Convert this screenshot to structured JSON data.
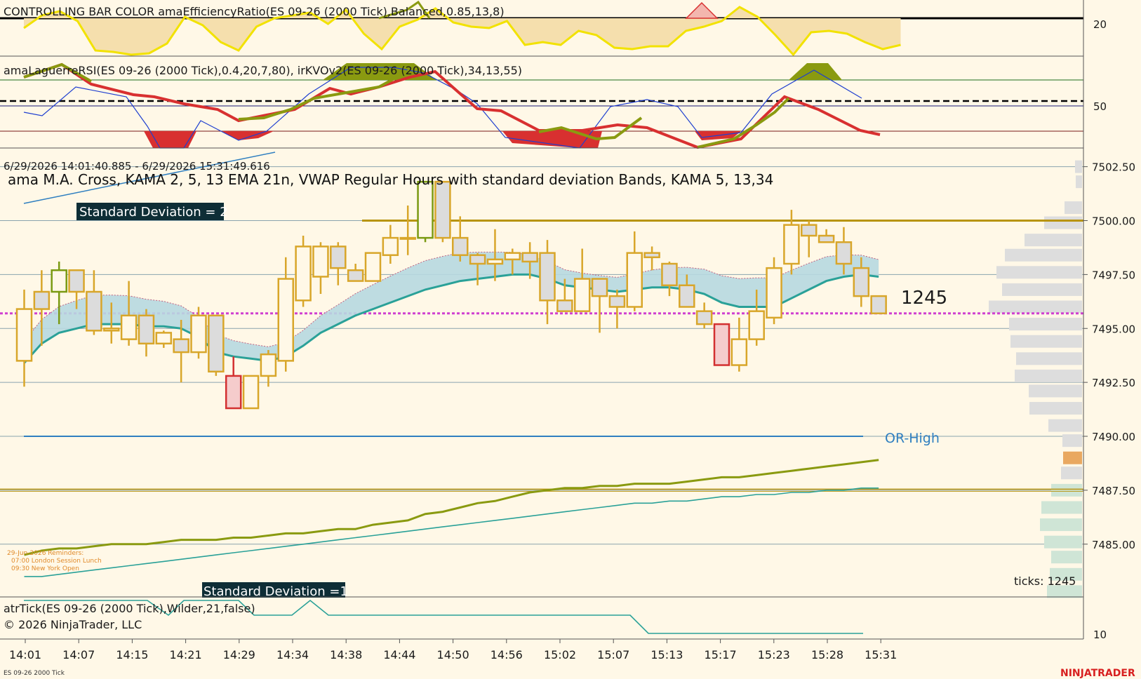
{
  "colors": {
    "background": "#fff8e7",
    "candle_border": "#d8a62a",
    "candle_up_fill": "#fff8e7",
    "candle_down_fill": "#dcdcdc",
    "candle_green_border": "#7a9a12",
    "candle_red_border": "#d33030",
    "candle_red_fill": "#f5cccc",
    "vwap": "#2aa198",
    "band_fill": "#b7d8e0",
    "band_line": "#c06080",
    "olive": "#8a9a10",
    "red_line": "#d83030",
    "blue": "#2244aa",
    "magenta": "#d040d0",
    "or_high": "#2f7fc0",
    "gold_line": "#b8940f"
  },
  "panels": {
    "efficiency": {
      "label": "CONTROLLING BAR COLOR amaEfficiencyRatio(ES 09-26 (2000 Tick),Balanced,0.85,13,8)",
      "tick": "20"
    },
    "laguerre": {
      "label": "amaLaguerreRSI(ES 09-26 (2000 Tick),0.4,20,7,80), irKVOv2(ES 09-26 (2000 Tick),34,13,55)",
      "tick": "50"
    },
    "price": {
      "time_range": "6/29/2026 14:01:40.885 - 6/29/2026 15:31:49.616",
      "title": "ama M.A. Cross,  KAMA  2, 5, 13 EMA 21n, VWAP Regular Hours with standard deviation Bands, KAMA 5, 13,34",
      "std2_label": "Standard Deviation = 2",
      "std1_label": "Standard Deviation =1",
      "or_high_label": "OR-High",
      "tick_count_label": "1245",
      "ticks_label": "ticks: 1245",
      "reminders": [
        "29-Jun-2026 Reminders:",
        "07:00 London Session Lunch",
        "09:30 New York Open"
      ],
      "y_ticks": [
        "7502.50",
        "7500.00",
        "7497.50",
        "7495.00",
        "7492.50",
        "7490.00",
        "7487.50",
        "7485.00"
      ]
    },
    "atr": {
      "label": "atrTick(ES 09-26 (2000 Tick),Wilder,21,false)",
      "tick": "10"
    }
  },
  "copyright": "© 2026 NinjaTrader, LLC",
  "footer_instrument": "ES 09-26 2000 Tick",
  "brand": "NINJATRADER",
  "chart_data": {
    "type": "candlestick",
    "instrument": "ES 09-26 (2000 Tick)",
    "x_labels": [
      "14:01",
      "14:07",
      "14:15",
      "14:21",
      "14:29",
      "14:34",
      "14:38",
      "14:44",
      "14:50",
      "14:56",
      "15:02",
      "15:07",
      "15:13",
      "15:17",
      "15:23",
      "15:28",
      "15:31"
    ],
    "y_range": [
      7483.2,
      7503.3
    ],
    "candles": [
      {
        "o": 7493.5,
        "h": 7496.8,
        "l": 7492.3,
        "c": 7495.9
      },
      {
        "o": 7496.7,
        "h": 7497.7,
        "l": 7494.2,
        "c": 7495.9
      },
      {
        "o": 7496.7,
        "h": 7498.1,
        "l": 7495.2,
        "c": 7497.7,
        "color": "green"
      },
      {
        "o": 7497.7,
        "h": 7497.7,
        "l": 7495.9,
        "c": 7496.7
      },
      {
        "o": 7496.7,
        "h": 7497.7,
        "l": 7494.7,
        "c": 7494.9
      },
      {
        "o": 7494.9,
        "h": 7496.2,
        "l": 7494.3,
        "c": 7495.0
      },
      {
        "o": 7494.5,
        "h": 7497.2,
        "l": 7494.2,
        "c": 7495.6
      },
      {
        "o": 7495.6,
        "h": 7495.9,
        "l": 7493.7,
        "c": 7494.3
      },
      {
        "o": 7494.3,
        "h": 7494.9,
        "l": 7494.1,
        "c": 7494.8
      },
      {
        "o": 7494.5,
        "h": 7495.4,
        "l": 7492.5,
        "c": 7493.9
      },
      {
        "o": 7493.9,
        "h": 7496.0,
        "l": 7493.6,
        "c": 7495.6
      },
      {
        "o": 7495.6,
        "h": 7495.6,
        "l": 7492.8,
        "c": 7493.0
      },
      {
        "o": 7492.8,
        "h": 7493.7,
        "l": 7491.3,
        "c": 7491.3,
        "color": "red"
      },
      {
        "o": 7491.3,
        "h": 7492.8,
        "l": 7491.3,
        "c": 7492.8
      },
      {
        "o": 7492.8,
        "h": 7494.0,
        "l": 7492.3,
        "c": 7493.8
      },
      {
        "o": 7493.5,
        "h": 7498.3,
        "l": 7493.0,
        "c": 7497.3
      },
      {
        "o": 7496.3,
        "h": 7499.3,
        "l": 7496.0,
        "c": 7498.8
      },
      {
        "o": 7497.4,
        "h": 7499.0,
        "l": 7496.6,
        "c": 7498.8
      },
      {
        "o": 7498.8,
        "h": 7499.0,
        "l": 7497.0,
        "c": 7497.8
      },
      {
        "o": 7497.7,
        "h": 7498.0,
        "l": 7497.2,
        "c": 7497.2
      },
      {
        "o": 7497.2,
        "h": 7498.5,
        "l": 7497.2,
        "c": 7498.5
      },
      {
        "o": 7498.4,
        "h": 7499.8,
        "l": 7498.0,
        "c": 7499.2
      },
      {
        "o": 7499.2,
        "h": 7500.7,
        "l": 7498.4,
        "c": 7499.2
      },
      {
        "o": 7499.2,
        "h": 7501.8,
        "l": 7499.0,
        "c": 7501.8,
        "color": "green"
      },
      {
        "o": 7501.8,
        "h": 7501.8,
        "l": 7499.0,
        "c": 7499.2
      },
      {
        "o": 7499.2,
        "h": 7500.2,
        "l": 7498.1,
        "c": 7498.4
      },
      {
        "o": 7498.4,
        "h": 7498.5,
        "l": 7497.0,
        "c": 7498.0
      },
      {
        "o": 7498.0,
        "h": 7499.6,
        "l": 7497.2,
        "c": 7498.2
      },
      {
        "o": 7498.2,
        "h": 7498.7,
        "l": 7497.5,
        "c": 7498.5
      },
      {
        "o": 7498.5,
        "h": 7499.0,
        "l": 7497.3,
        "c": 7498.1
      },
      {
        "o": 7498.5,
        "h": 7499.1,
        "l": 7495.2,
        "c": 7496.3
      },
      {
        "o": 7496.3,
        "h": 7497.3,
        "l": 7495.8,
        "c": 7495.8
      },
      {
        "o": 7495.8,
        "h": 7498.7,
        "l": 7495.8,
        "c": 7497.3
      },
      {
        "o": 7497.3,
        "h": 7497.3,
        "l": 7494.8,
        "c": 7496.5
      },
      {
        "o": 7496.5,
        "h": 7496.8,
        "l": 7495.0,
        "c": 7496.0
      },
      {
        "o": 7496.0,
        "h": 7499.5,
        "l": 7495.8,
        "c": 7498.5
      },
      {
        "o": 7498.5,
        "h": 7498.8,
        "l": 7497.7,
        "c": 7498.3
      },
      {
        "o": 7498.0,
        "h": 7498.1,
        "l": 7496.5,
        "c": 7497.0
      },
      {
        "o": 7497.0,
        "h": 7497.5,
        "l": 7496.0,
        "c": 7496.0
      },
      {
        "o": 7495.8,
        "h": 7496.2,
        "l": 7495.0,
        "c": 7495.2
      },
      {
        "o": 7495.2,
        "h": 7495.2,
        "l": 7493.3,
        "c": 7493.3,
        "color": "red"
      },
      {
        "o": 7493.3,
        "h": 7495.5,
        "l": 7493.0,
        "c": 7494.5
      },
      {
        "o": 7494.5,
        "h": 7496.8,
        "l": 7494.2,
        "c": 7495.8
      },
      {
        "o": 7495.5,
        "h": 7498.3,
        "l": 7495.2,
        "c": 7497.8
      },
      {
        "o": 7498.0,
        "h": 7500.5,
        "l": 7497.5,
        "c": 7499.8
      },
      {
        "o": 7499.8,
        "h": 7500.0,
        "l": 7498.3,
        "c": 7499.3
      },
      {
        "o": 7499.3,
        "h": 7499.6,
        "l": 7499.0,
        "c": 7499.0
      },
      {
        "o": 7499.0,
        "h": 7499.7,
        "l": 7497.5,
        "c": 7498.0
      },
      {
        "o": 7497.8,
        "h": 7498.3,
        "l": 7496.0,
        "c": 7496.5
      },
      {
        "o": 7496.5,
        "h": 7496.5,
        "l": 7495.8,
        "c": 7495.7
      }
    ],
    "levels": {
      "std_dev_2": 7500.0,
      "current": 7495.7,
      "or_high": 7490.0,
      "gold_low": 7487.5
    },
    "series": [
      {
        "name": "VWAP",
        "values": [
          7493.4,
          7494.3,
          7494.8,
          7495.0,
          7495.2,
          7495.2,
          7495.2,
          7495.1,
          7495.1,
          7495.0,
          7494.6,
          7493.9,
          7493.7,
          7493.6,
          7493.5,
          7493.7,
          7494.2,
          7494.8,
          7495.2,
          7495.6,
          7495.9,
          7496.2,
          7496.5,
          7496.8,
          7497.0,
          7497.2,
          7497.3,
          7497.4,
          7497.5,
          7497.5,
          7497.3,
          7497.0,
          7496.9,
          7496.8,
          7496.7,
          7496.8,
          7496.9,
          7496.9,
          7496.8,
          7496.6,
          7496.2,
          7496.0,
          7496.0,
          7496.0,
          7496.4,
          7496.8,
          7497.2,
          7497.4,
          7497.5,
          7497.4
        ]
      },
      {
        "name": "KAMA 5",
        "values": [
          7484.5,
          7484.7,
          7484.8,
          7484.8,
          7484.9,
          7485.0,
          7485.0,
          7485.0,
          7485.1,
          7485.2,
          7485.2,
          7485.2,
          7485.3,
          7485.3,
          7485.4,
          7485.5,
          7485.5,
          7485.6,
          7485.7,
          7485.7,
          7485.9,
          7486.0,
          7486.1,
          7486.4,
          7486.5,
          7486.7,
          7486.9,
          7487.0,
          7487.2,
          7487.4,
          7487.5,
          7487.6,
          7487.6,
          7487.7,
          7487.7,
          7487.8,
          7487.8,
          7487.8,
          7487.9,
          7488.0,
          7488.1,
          7488.1,
          7488.2,
          7488.3,
          7488.4,
          7488.5,
          7488.6,
          7488.7,
          7488.8,
          7488.9
        ]
      },
      {
        "name": "KAMA 13",
        "values": [
          7483.5,
          7483.5,
          7483.6,
          7483.7,
          7483.8,
          7483.9,
          7484.0,
          7484.1,
          7484.2,
          7484.3,
          7484.4,
          7484.5,
          7484.6,
          7484.7,
          7484.8,
          7484.9,
          7485.0,
          7485.1,
          7485.2,
          7485.3,
          7485.4,
          7485.5,
          7485.6,
          7485.7,
          7485.8,
          7485.9,
          7486.0,
          7486.1,
          7486.2,
          7486.3,
          7486.4,
          7486.5,
          7486.6,
          7486.7,
          7486.8,
          7486.9,
          7486.9,
          7487.0,
          7487.0,
          7487.1,
          7487.2,
          7487.2,
          7487.3,
          7487.3,
          7487.4,
          7487.4,
          7487.5,
          7487.5,
          7487.6,
          7487.6
        ]
      }
    ]
  }
}
